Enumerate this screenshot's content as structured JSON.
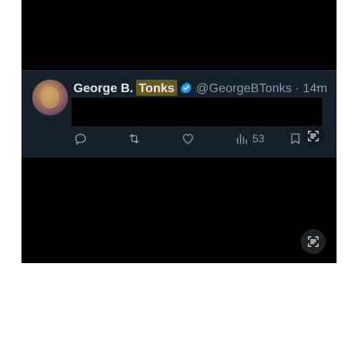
{
  "tweet": {
    "author_name_first": "George B.",
    "author_name_highlight": "Tonks",
    "handle_time": "@GeorgeBTonks · 14m",
    "more_label": "···",
    "views_count": "53"
  },
  "icons": {
    "avatar": "profile-photo",
    "verified": "verified-badge-icon",
    "reply": "reply-icon",
    "retweet": "retweet-icon",
    "like": "heart-icon",
    "views": "analytics-icon",
    "bookmark": "bookmark-icon",
    "lens": "lens-search-icon"
  },
  "colors": {
    "background": "#000000",
    "tweet_background": "#15202b",
    "text_primary": "#e7e9ea",
    "text_secondary": "#8b98a5",
    "highlight": "#6b5a1e",
    "verified": "#1d9bf0"
  }
}
